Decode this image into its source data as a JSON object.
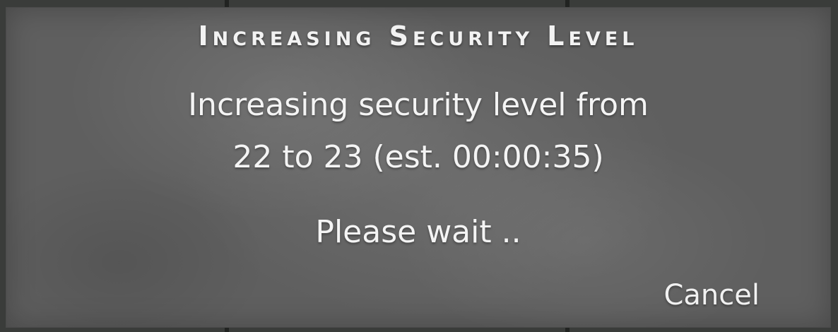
{
  "dialog": {
    "title": "Increasing Security Level",
    "message_line1": "Increasing security level from",
    "message_line2": "22 to 23 (est. 00:00:35)",
    "status": "Please wait ..",
    "cancel_label": "Cancel"
  }
}
